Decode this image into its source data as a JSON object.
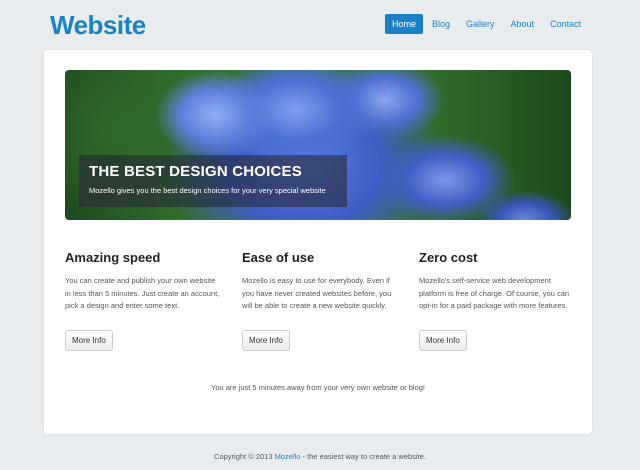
{
  "header": {
    "logo": "Website",
    "nav": [
      "Home",
      "Blog",
      "Gallery",
      "About",
      "Contact"
    ],
    "active_index": 0
  },
  "hero": {
    "title": "THE BEST DESIGN CHOICES",
    "subtitle": "Mozello gives you the best design choices for your very special website"
  },
  "features": [
    {
      "title": "Amazing speed",
      "text": "You can create and publish your own website in less than 5 minutes. Just create an account, pick a design and enter some text.",
      "button": "More Info"
    },
    {
      "title": "Ease of use",
      "text": "Mozello is easy to use for everybody. Even if you have never created websites before, you will be able to create a new website quickly.",
      "button": "More Info"
    },
    {
      "title": "Zero cost",
      "text": "Mozello's self-service web development platform is free of charge. Of course, you can opt-in for a paid package with more features.",
      "button": "More Info"
    }
  ],
  "tagline": "You are just 5 minutes away from your very own website or blog!",
  "footer": {
    "prefix": "Copyright © 2013",
    "link": "Mozello",
    "suffix": "- the easiest way to create a website."
  },
  "colors": {
    "accent": "#1a82c4",
    "background": "#e9ecef"
  }
}
